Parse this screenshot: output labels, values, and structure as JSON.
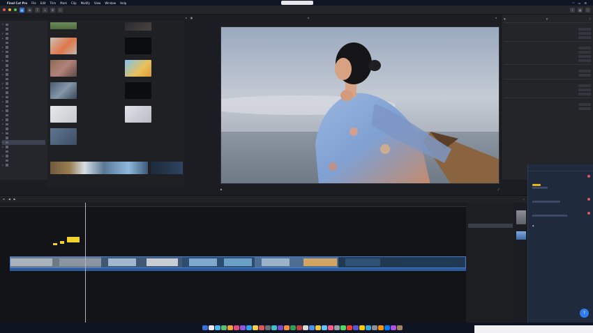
{
  "menubar": {
    "app_name": "Final Cut Pro",
    "menus": [
      "File",
      "Edit",
      "Trim",
      "Mark",
      "Clip",
      "Modify",
      "View",
      "Window",
      "Help"
    ],
    "center_pill": "",
    "right_items": [
      "",
      "",
      ""
    ]
  },
  "dock_icons": [
    "#3a6fd8",
    "#e8e8ea",
    "#4cb7f5",
    "#56c26a",
    "#f4a23b",
    "#e24a7a",
    "#9257e0",
    "#2fa4f0",
    "#f5d24a",
    "#e05555",
    "#6b6f78",
    "#3fc1c9",
    "#7a4bd1",
    "#ff8a3d",
    "#2e9e5b",
    "#c43d3d",
    "#d9d9d9",
    "#4a8ef0",
    "#f2c33c",
    "#5ac8fa",
    "#ff5b8f",
    "#9aa0a8",
    "#4cd964",
    "#ff3b30",
    "#5856d6",
    "#ffcc00",
    "#34aadc",
    "#8e8e93",
    "#ff9500",
    "#007aff",
    "#af52de",
    "#a2845e"
  ],
  "chat": {
    "tabs": [
      "",
      ""
    ],
    "messages": [
      {
        "text": "",
        "has_badge": true
      },
      {
        "text": "",
        "has_badge": false
      },
      {
        "text": "",
        "has_badge": false
      }
    ],
    "help_icon": "help-icon",
    "brand_color": "#2f7cf0"
  },
  "accent_colors": {
    "blue": "#2f6fd9",
    "title_yellow": "#f2d22b",
    "badge_red": "#e05561"
  }
}
